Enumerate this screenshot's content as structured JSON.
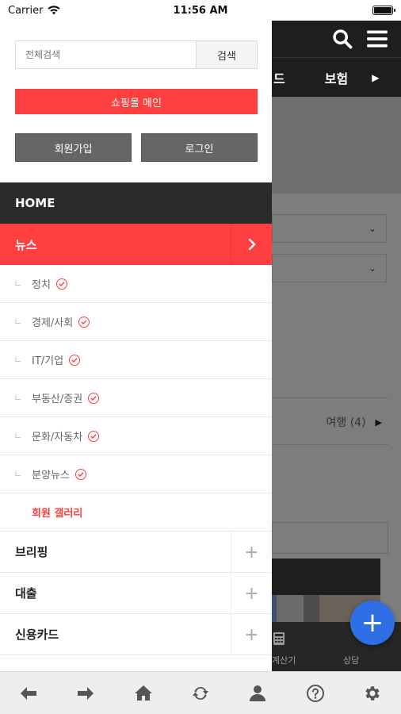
{
  "status_bar": {
    "carrier": "Carrier",
    "time": "11:56 AM"
  },
  "drawer": {
    "search_placeholder": "전체검색",
    "search_button": "검색",
    "mall_button": "쇼핑몰 메인",
    "join_button": "회원가입",
    "login_button": "로그인",
    "home": "HOME",
    "news": "뉴스",
    "sub_items": [
      "정치",
      "경제/사회",
      "IT/기업",
      "부동산/증권",
      "문화/자동차",
      "분양뉴스"
    ],
    "gallery": "회원 갤러리",
    "categories": [
      "브리핑",
      "대출",
      "신용카드"
    ]
  },
  "background": {
    "tab_partial": "드",
    "tab_insurance": "보험",
    "travel": "여행 (4)",
    "calc_label": "계산기",
    "consult_label": "상담"
  },
  "icons": {
    "search": "search-icon",
    "menu": "hamburger-icon",
    "fab": "plus-icon",
    "toolbar": [
      "back-arrow-icon",
      "forward-arrow-icon",
      "home-icon",
      "refresh-icon",
      "user-icon",
      "help-icon",
      "settings-icon"
    ]
  },
  "colors": {
    "accent": "#ff3f3f",
    "dark": "#2b2b2b",
    "fab": "#2e6fe6"
  }
}
